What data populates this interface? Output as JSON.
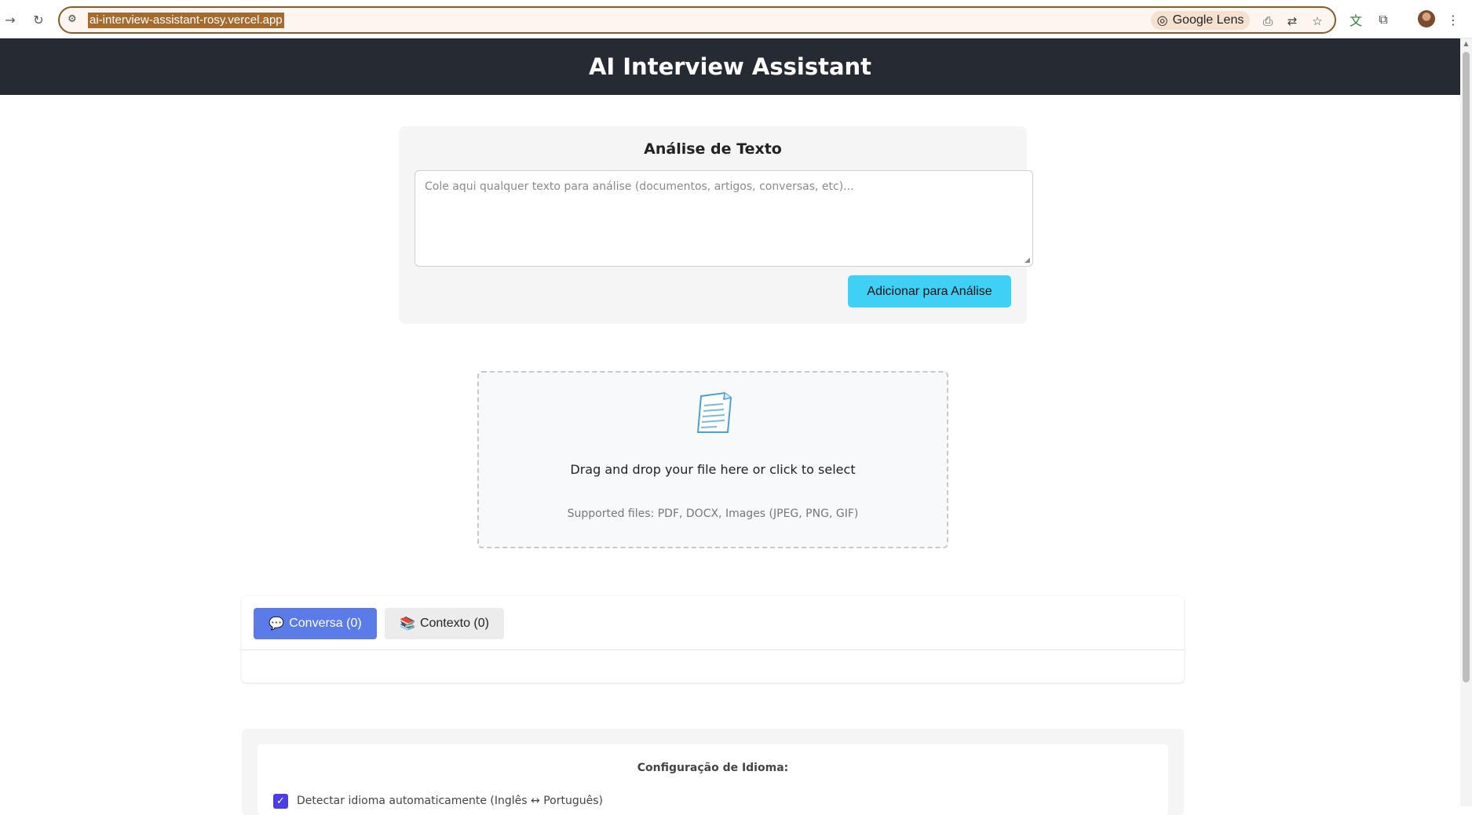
{
  "browser": {
    "url": "ai-interview-assistant-rosy.vercel.app",
    "lens_label": "Google Lens"
  },
  "app": {
    "title": "AI Interview Assistant"
  },
  "analysis": {
    "title": "Análise de Texto",
    "placeholder": "Cole aqui qualquer texto para análise (documentos, artigos, conversas, etc)...",
    "add_button": "Adicionar para Análise"
  },
  "upload": {
    "drop_text": "Drag and drop your file here or click to select",
    "supported_text": "Supported files: PDF, DOCX, Images (JPEG, PNG, GIF)"
  },
  "tabs": [
    {
      "icon": "💬",
      "label": "Conversa (0)",
      "active": true
    },
    {
      "icon": "📚",
      "label": "Contexto (0)",
      "active": false
    }
  ],
  "language": {
    "title": "Configuração de Idioma:",
    "auto_detect_label": "Detectar idioma automaticamente (Inglês ↔ Português)",
    "auto_detect_checked": true
  },
  "colors": {
    "header_bg": "#262b33",
    "add_button_bg": "#3fd0f5",
    "active_tab_bg": "#5a7be8",
    "checkbox_bg": "#4a3fe0"
  }
}
